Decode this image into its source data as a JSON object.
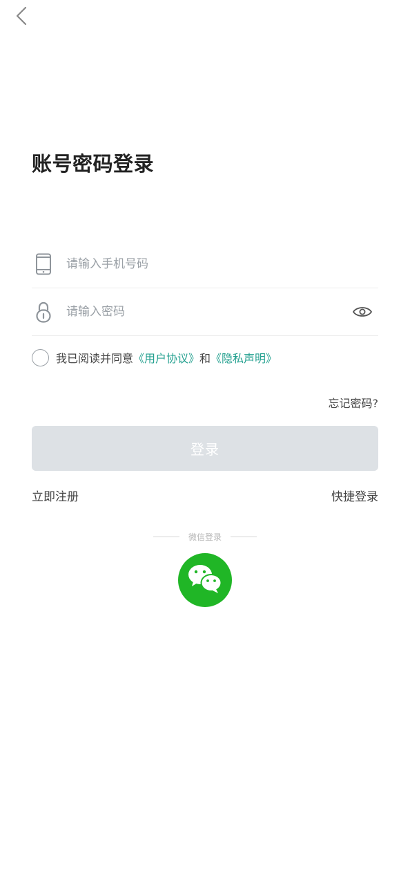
{
  "nav": {
    "back_icon": "chevron-left-icon"
  },
  "page": {
    "title": "账号密码登录"
  },
  "phone_field": {
    "icon": "phone-icon",
    "placeholder": "请输入手机号码",
    "value": ""
  },
  "password_field": {
    "icon": "lock-icon",
    "placeholder": "请输入密码",
    "value": "",
    "toggle_icon": "eye-icon"
  },
  "agreement": {
    "checked": false,
    "prefix": "我已阅读并同意",
    "user_agreement": "《用户协议》",
    "and": "和",
    "privacy": "《隐私声明》",
    "link_color": "#23a08f"
  },
  "forgot_password": "忘记密码?",
  "login_button": {
    "label": "登录",
    "enabled": false,
    "bg_color": "#dde1e5"
  },
  "register_link": "立即注册",
  "quick_login_link": "快捷登录",
  "third_party": {
    "divider_text": "微信登录",
    "wechat_icon": "wechat-icon",
    "wechat_color": "#20b626"
  }
}
